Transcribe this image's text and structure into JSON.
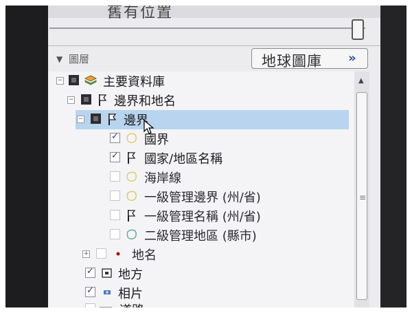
{
  "app": {
    "top_title": "舊有位置"
  },
  "layers_panel": {
    "label": "圖層",
    "gallery_button": "地球圖庫",
    "gallery_chevron": "»"
  },
  "tree": {
    "items": [
      {
        "label": "主要資料庫",
        "state": "filled",
        "icon": "layers-icon"
      },
      {
        "label": "邊界和地名",
        "state": "filled",
        "icon": "flag-icon"
      },
      {
        "label": "邊界",
        "state": "filled",
        "icon": "flag-icon",
        "selected": true
      },
      {
        "label": "國界",
        "state": "checked",
        "icon": "border-shape-icon"
      },
      {
        "label": "國家/地區名稱",
        "state": "checked",
        "icon": "flag-icon"
      },
      {
        "label": "海岸線",
        "state": "unchecked",
        "icon": "border-shape-icon"
      },
      {
        "label": "一級管理邊界 (州/省)",
        "state": "unchecked",
        "icon": "border-shape-icon"
      },
      {
        "label": "一級管理名稱 (州/省)",
        "state": "unchecked",
        "icon": "flag-icon"
      },
      {
        "label": "二級管理地區 (縣市)",
        "state": "unchecked",
        "icon": "region-shape-icon"
      },
      {
        "label": "地名",
        "state": "unchecked",
        "icon": "place-dot-icon"
      },
      {
        "label": "地方",
        "state": "checked",
        "icon": "local-icon"
      },
      {
        "label": "相片",
        "state": "checked",
        "icon": "photo-icon"
      },
      {
        "label": "道路",
        "state": "unchecked",
        "icon": "road-icon"
      }
    ]
  },
  "colors": {
    "selection": "#b9d4ee",
    "accent": "#2a4f9e"
  }
}
